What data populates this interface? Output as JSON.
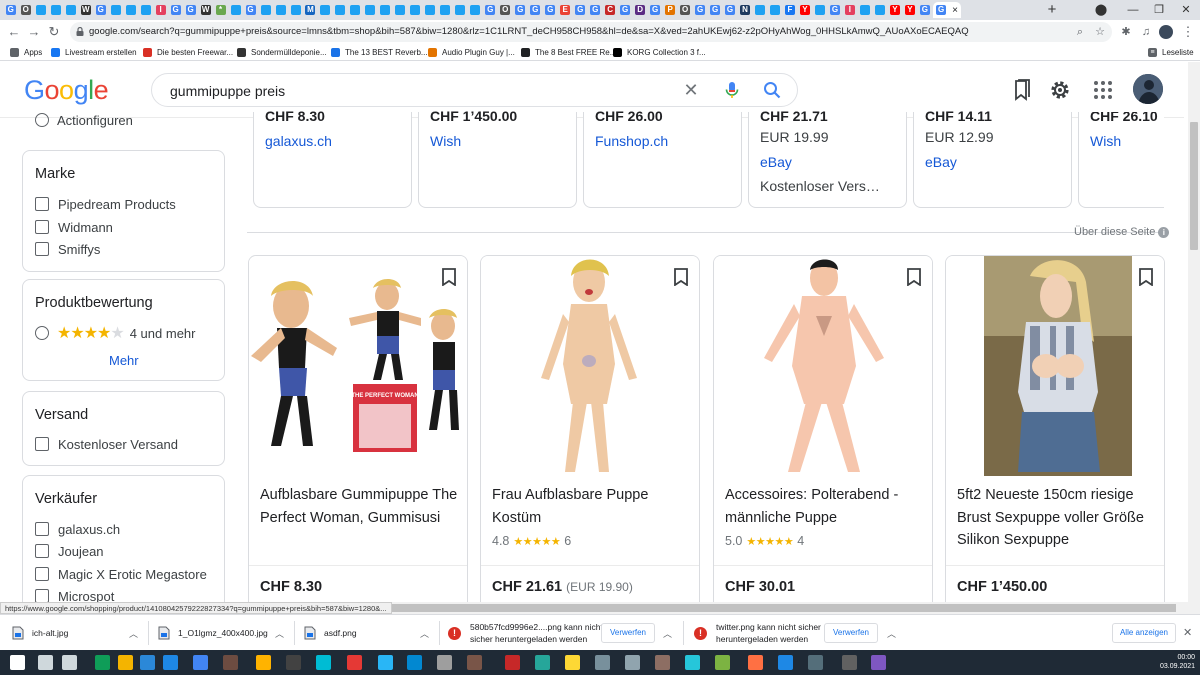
{
  "browser": {
    "tab_favicons": [
      "G",
      "O",
      "T",
      "T",
      "T",
      "W",
      "G",
      "T",
      "T",
      "T",
      "I",
      "G",
      "G",
      "W",
      "*",
      "T",
      "G",
      "T",
      "T",
      "T",
      "M",
      "T",
      "T",
      "T",
      "T",
      "T",
      "T",
      "T",
      "T",
      "T",
      "T",
      "T",
      "G",
      "O",
      "G",
      "G",
      "G",
      "E",
      "G",
      "G",
      "C",
      "G",
      "D",
      "G",
      "P",
      "O",
      "G",
      "G",
      "G",
      "N",
      "T",
      "T",
      "F",
      "Y",
      "T",
      "G",
      "I",
      "T",
      "T",
      "Y",
      "Y",
      "G"
    ],
    "active_tab_close": "×",
    "new_tab": "+",
    "url": "google.com/search?q=gummipuppe+preis&source=lmns&tbm=shop&bih=587&biw=1280&rlz=1C1LRNT_deCH958CH958&hl=de&sa=X&ved=2ahUKEwj62-z2pOHyAhWog_0HHSLkAmwQ_AUoAXoECAEQAQ",
    "bookmarks": [
      {
        "label": "Apps",
        "icon": "apps-grid",
        "color": "#5f6368"
      },
      {
        "label": "Livestream erstellen",
        "icon": "facebook",
        "color": "#1877f2"
      },
      {
        "label": "Die besten Freewar...",
        "icon": "star",
        "color": "#d93025"
      },
      {
        "label": "Sondermülldeponie...",
        "icon": "w",
        "color": "#333333"
      },
      {
        "label": "The 13 BEST Reverb...",
        "icon": "waveform",
        "color": "#1a73e8"
      },
      {
        "label": "Audio Plugin Guy |...",
        "icon": "plugin",
        "color": "#e37400"
      },
      {
        "label": "The 8 Best FREE Re...",
        "icon": "circle",
        "color": "#202124"
      },
      {
        "label": "KORG Collection 3 f...",
        "icon": "korg",
        "color": "#000000"
      }
    ],
    "reading_list": "Leseliste"
  },
  "google": {
    "logo": "Google",
    "query": "gummipuppe preis"
  },
  "filters": {
    "category_item": "Actionfiguren",
    "brand": {
      "title": "Marke",
      "items": [
        "Pipedream Products",
        "Widmann",
        "Smiffys"
      ]
    },
    "rating": {
      "title": "Produktbewertung",
      "stars": 4,
      "label": "4 und mehr",
      "more": "Mehr"
    },
    "shipping": {
      "title": "Versand",
      "items": [
        "Kostenloser Versand"
      ]
    },
    "sellers": {
      "title": "Verkäufer",
      "items": [
        "galaxus.ch",
        "Joujean",
        "Magic X Erotic Megastore",
        "Microspot"
      ]
    }
  },
  "top_cards": [
    {
      "price": "CHF 8.30",
      "seller": "galaxus.ch"
    },
    {
      "price": "CHF 1’450.00",
      "seller": "Wish"
    },
    {
      "price": "CHF 26.00",
      "seller": "Funshop.ch"
    },
    {
      "price": "CHF 21.71",
      "orig": "EUR 19.99",
      "seller": "eBay",
      "extra": "Kostenloser Vers…"
    },
    {
      "price": "CHF 14.11",
      "orig": "EUR 12.99",
      "seller": "eBay"
    },
    {
      "price": "CHF 26.10",
      "seller": "Wish"
    }
  ],
  "about_page": "Über diese Seite",
  "products": [
    {
      "title": "Aufblasbare Gummipuppe The Perfect Woman, Gummisusi",
      "price": "CHF 8.30",
      "box_text": "THE PERFECT WOMAN"
    },
    {
      "title": "Frau Aufblasbare Puppe Kostüm",
      "rating": "4.8",
      "stars": "★★★★★",
      "reviews": "6",
      "price": "CHF 21.61",
      "orig": "(EUR 19.90)"
    },
    {
      "title": "Accessoires: Polterabend - männliche Puppe",
      "rating": "5.0",
      "stars": "★★★★★",
      "reviews": "4",
      "price": "CHF 30.01"
    },
    {
      "title": "5ft2 Neueste 150cm riesige Brust Sexpuppe voller Größe Silikon Sexpuppe",
      "price": "CHF 1’450.00"
    }
  ],
  "status_url": "https://www.google.com/shopping/product/14108042579222827334?q=gummipuppe+preis&bih=587&biw=1280&...",
  "downloads": [
    {
      "name": "ich-alt.jpg"
    },
    {
      "name": "1_O1lgmz_400x400.jpg"
    },
    {
      "name": "asdf.png"
    },
    {
      "line1": "580b57fcd9996e2....png kann nicht",
      "line2": "sicher heruntergeladen werden",
      "button": "Verwerfen"
    },
    {
      "line1": "twitter.png kann nicht sicher",
      "line2": "heruntergeladen werden",
      "button": "Verwerfen"
    }
  ],
  "show_all": "Alle anzeigen",
  "taskbar": {
    "time": "00:00",
    "date": "03.09.2021"
  }
}
